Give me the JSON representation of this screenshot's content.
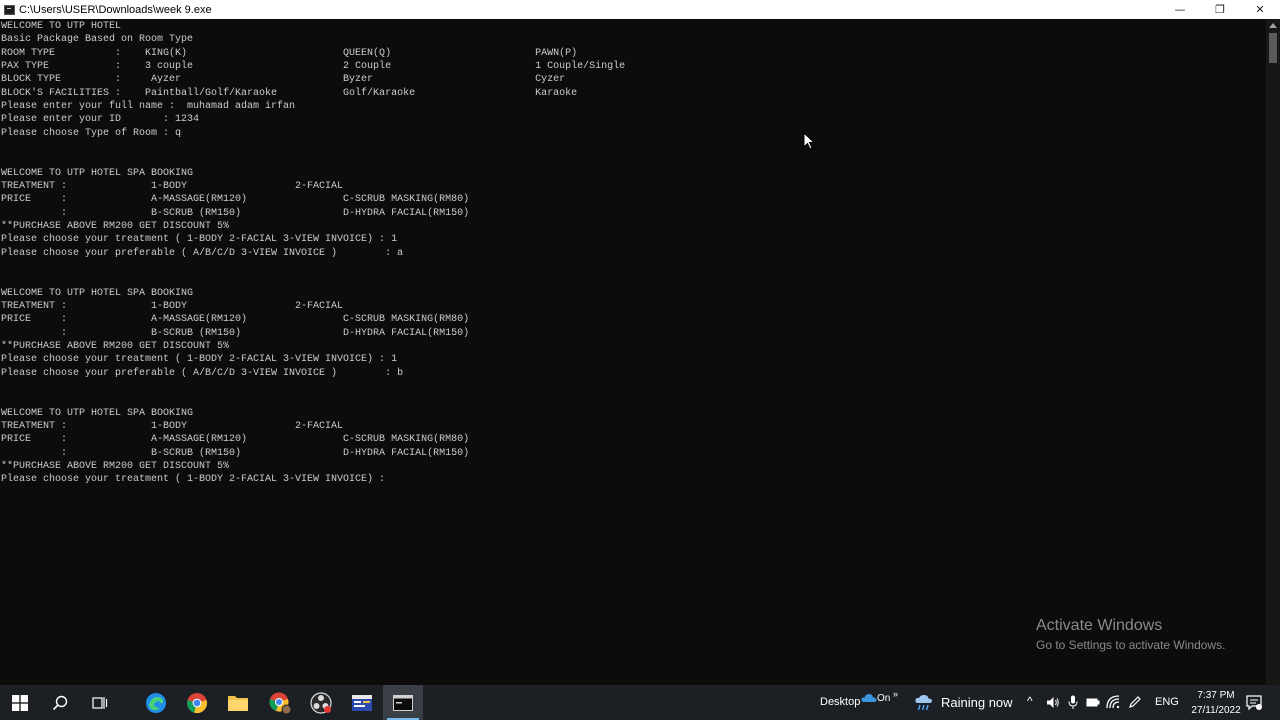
{
  "window": {
    "title": "C:\\Users\\USER\\Downloads\\week 9.exe",
    "minimize_glyph": "—",
    "restore_glyph": "❐",
    "close_glyph": "✕"
  },
  "console": {
    "lines": [
      "WELCOME TO UTP HOTEL",
      "Basic Package Based on Room Type",
      "ROOM TYPE          :    KING(K)                          QUEEN(Q)                        PAWN(P)",
      "PAX TYPE           :    3 couple                         2 Couple                        1 Couple/Single",
      "BLOCK TYPE         :     Ayzer                           Byzer                           Cyzer",
      "BLOCK'S FACILITIES :    Paintball/Golf/Karaoke           Golf/Karaoke                    Karaoke",
      "Please enter your full name :  muhamad adam irfan",
      "Please enter your ID       : 1234",
      "Please choose Type of Room : q",
      "",
      "",
      "WELCOME TO UTP HOTEL SPA BOOKING",
      "TREATMENT :              1-BODY                  2-FACIAL",
      "PRICE     :              A-MASSAGE(RM120)                C-SCRUB MASKING(RM80)",
      "          :              B-SCRUB (RM150)                 D-HYDRA FACIAL(RM150)",
      "**PURCHASE ABOVE RM200 GET DISCOUNT 5%",
      "Please choose your treatment ( 1-BODY 2-FACIAL 3-VIEW INVOICE) : 1",
      "Please choose your preferable ( A/B/C/D 3-VIEW INVOICE )        : a",
      "",
      "",
      "WELCOME TO UTP HOTEL SPA BOOKING",
      "TREATMENT :              1-BODY                  2-FACIAL",
      "PRICE     :              A-MASSAGE(RM120)                C-SCRUB MASKING(RM80)",
      "          :              B-SCRUB (RM150)                 D-HYDRA FACIAL(RM150)",
      "**PURCHASE ABOVE RM200 GET DISCOUNT 5%",
      "Please choose your treatment ( 1-BODY 2-FACIAL 3-VIEW INVOICE) : 1",
      "Please choose your preferable ( A/B/C/D 3-VIEW INVOICE )        : b",
      "",
      "",
      "WELCOME TO UTP HOTEL SPA BOOKING",
      "TREATMENT :              1-BODY                  2-FACIAL",
      "PRICE     :              A-MASSAGE(RM120)                C-SCRUB MASKING(RM80)",
      "          :              B-SCRUB (RM150)                 D-HYDRA FACIAL(RM150)",
      "**PURCHASE ABOVE RM200 GET DISCOUNT 5%",
      "Please choose your treatment ( 1-BODY 2-FACIAL 3-VIEW INVOICE) :"
    ]
  },
  "watermark": {
    "title": "Activate Windows",
    "subtitle": "Go to Settings to activate Windows."
  },
  "taskbar": {
    "pinned_icons": [
      "windows-start-icon",
      "search-icon",
      "task-view-icon",
      "edge-icon",
      "chrome-icon",
      "file-explorer-icon",
      "chrome-profile-icon",
      "obs-icon",
      "dev-cpp-icon",
      "console-app-icon"
    ],
    "desktop_label": "Desktop",
    "onedrive_label": "On",
    "weather_label": "Raining now",
    "language": "ENG",
    "time": "7:37 PM",
    "date": "27/11/2022"
  },
  "colors": {
    "console_bg": "#0c0c0c",
    "console_fg": "#cccccc",
    "taskbar_bg": "#1c1f24",
    "accent": "#76b9ed"
  }
}
